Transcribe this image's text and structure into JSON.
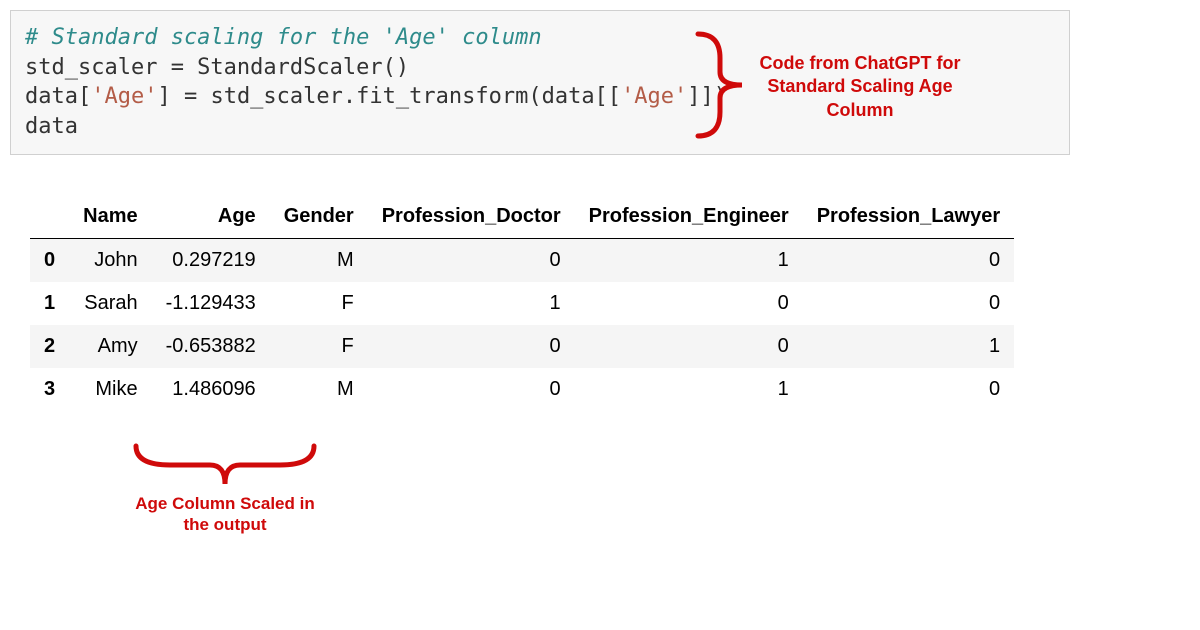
{
  "code": {
    "line1": "# Standard scaling for the 'Age' column",
    "line2_a": "std_scaler = StandardScaler()",
    "line3_a": "data[",
    "line3_str1": "'Age'",
    "line3_b": "] = std_scaler.fit_transform(data[[",
    "line3_str2": "'Age'",
    "line3_c": "]])",
    "line4": "data"
  },
  "annotations": {
    "right": "Code from ChatGPT for Standard Scaling Age Column",
    "bottom": "Age Column Scaled in the output"
  },
  "table": {
    "headers": {
      "index": "",
      "name": "Name",
      "age": "Age",
      "gender": "Gender",
      "prof_doc": "Profession_Doctor",
      "prof_eng": "Profession_Engineer",
      "prof_law": "Profession_Lawyer"
    },
    "rows": [
      {
        "idx": "0",
        "name": "John",
        "age": "0.297219",
        "gender": "M",
        "prof_doc": "0",
        "prof_eng": "1",
        "prof_law": "0"
      },
      {
        "idx": "1",
        "name": "Sarah",
        "age": "-1.129433",
        "gender": "F",
        "prof_doc": "1",
        "prof_eng": "0",
        "prof_law": "0"
      },
      {
        "idx": "2",
        "name": "Amy",
        "age": "-0.653882",
        "gender": "F",
        "prof_doc": "0",
        "prof_eng": "0",
        "prof_law": "1"
      },
      {
        "idx": "3",
        "name": "Mike",
        "age": "1.486096",
        "gender": "M",
        "prof_doc": "0",
        "prof_eng": "1",
        "prof_law": "0"
      }
    ]
  }
}
